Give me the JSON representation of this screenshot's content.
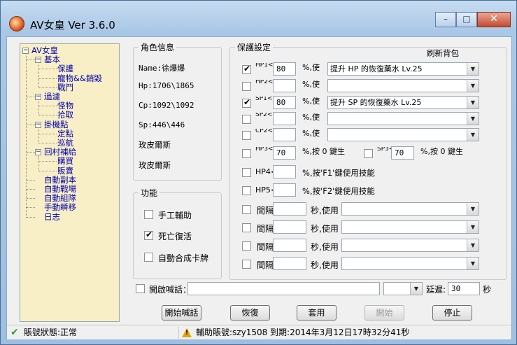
{
  "window": {
    "title": "AV女皇   Ver  3.6.0",
    "min_glyph": "–",
    "max_glyph": "□",
    "close_glyph": "✕"
  },
  "tree": {
    "root": "AV女皇",
    "nodes": [
      {
        "label": "基本",
        "level": 1,
        "expanded": true
      },
      {
        "label": "保護",
        "level": 2
      },
      {
        "label": "寵物&&銷毀",
        "level": 2
      },
      {
        "label": "戰鬥",
        "level": 2
      },
      {
        "label": "過濾",
        "level": 1,
        "expanded": true
      },
      {
        "label": "怪物",
        "level": 2
      },
      {
        "label": "拾取",
        "level": 2
      },
      {
        "label": "掛機點",
        "level": 1,
        "expanded": true
      },
      {
        "label": "定點",
        "level": 2
      },
      {
        "label": "巡航",
        "level": 2
      },
      {
        "label": "回村補給",
        "level": 1,
        "expanded": true
      },
      {
        "label": "購買",
        "level": 2
      },
      {
        "label": "販賣",
        "level": 2
      },
      {
        "label": "自動副本",
        "level": 1
      },
      {
        "label": "自動戰場",
        "level": 1
      },
      {
        "label": "自動組隊",
        "level": 1
      },
      {
        "label": "手動瞬移",
        "level": 1
      },
      {
        "label": "日志",
        "level": 1
      }
    ]
  },
  "role": {
    "title": "角色信息",
    "name": "Name:徐爆爆",
    "hp": "Hp:1706\\1865",
    "cp": "Cp:1092\\1092",
    "sp": "Sp:446\\446",
    "line5": "玫皮爾斯",
    "line6": "玫皮爾斯"
  },
  "functions": {
    "title": "功能",
    "items": [
      {
        "label": "手工輔助",
        "checked": false
      },
      {
        "label": "死亡復活",
        "checked": true
      },
      {
        "label": "自動合成卡牌",
        "checked": false
      }
    ]
  },
  "protect": {
    "title": "保護設定",
    "refresh": "刷新背包",
    "rows": [
      {
        "checked": true,
        "label": "HP1<",
        "value": "80",
        "suffix": "%,使",
        "item": "提升 HP 的恢復藥水 Lv.25"
      },
      {
        "checked": false,
        "label": "HP2<",
        "value": "",
        "suffix": "%,使",
        "item": ""
      },
      {
        "checked": true,
        "label": "SP1<",
        "value": "80",
        "suffix": "%,使",
        "item": "提升 SP 的恢復藥水 Lv.25"
      },
      {
        "checked": false,
        "label": "SP2<",
        "value": "",
        "suffix": "%,使",
        "item": ""
      },
      {
        "checked": false,
        "label": "CP2<",
        "value": "",
        "suffix": "%,使",
        "item": ""
      }
    ],
    "hp3": {
      "checked": false,
      "label": "HP3<",
      "value": "70",
      "suffix": "%,按 0 鍵生"
    },
    "sp3": {
      "checked": false,
      "label": "SP3<",
      "value": "70",
      "suffix": "%,按 0 鍵生"
    },
    "hp4": {
      "checked": false,
      "label": "HP4<",
      "value": "",
      "suffix": "%,按'F1'鍵使用技能"
    },
    "hp5": {
      "checked": false,
      "label": "HP5<",
      "value": "",
      "suffix": "%,按'F2'鍵使用技能"
    },
    "intervals": [
      {
        "checked": false,
        "label": "間隔",
        "value": "",
        "unit": "秒,使用",
        "item": ""
      },
      {
        "checked": false,
        "label": "間隔",
        "value": "",
        "unit": "秒,使用",
        "item": ""
      },
      {
        "checked": false,
        "label": "間隔",
        "value": "",
        "unit": "秒,使用",
        "item": ""
      },
      {
        "checked": false,
        "label": "間隔",
        "value": "",
        "unit": "秒,使用",
        "item": ""
      }
    ]
  },
  "shout": {
    "checked": false,
    "label": "開啟喊話：",
    "text": "",
    "select_value": "",
    "delay_label": "延遲:",
    "delay_value": "30",
    "delay_unit": "秒"
  },
  "buttons": {
    "start_shout": "開始喊話",
    "restore": "恢復",
    "apply": "套用",
    "start": "開始",
    "stop": "停止"
  },
  "status": {
    "account": "賬號狀態:正常",
    "aux": "輔助賬號:szy1508 到期:2014年3月12日17時32分41秒"
  }
}
